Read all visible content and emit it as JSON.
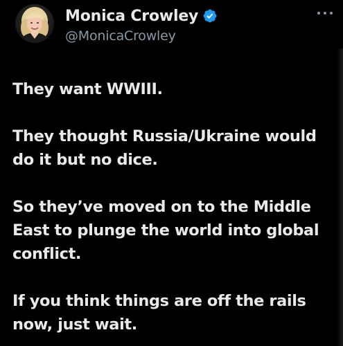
{
  "author": {
    "display_name": "Monica Crowley",
    "handle": "@MonicaCrowley",
    "verified": true,
    "avatar_icon": "profile-photo",
    "verified_icon": "verified-badge-icon",
    "verified_color": "#1d9bf0"
  },
  "menu": {
    "icon": "more-options-icon"
  },
  "tweet": {
    "paragraphs": [
      "They want WWIII.",
      "They thought Russia/Ukraine would\ndo it but no dice.",
      "So they’ve moved on to the Middle\nEast to plunge the world into global\nconflict.",
      "If you think things are off the rails\nnow, just wait."
    ]
  },
  "theme": {
    "background": "#000000",
    "text": "#e7e9ea",
    "secondary_text": "#8b98a5"
  }
}
